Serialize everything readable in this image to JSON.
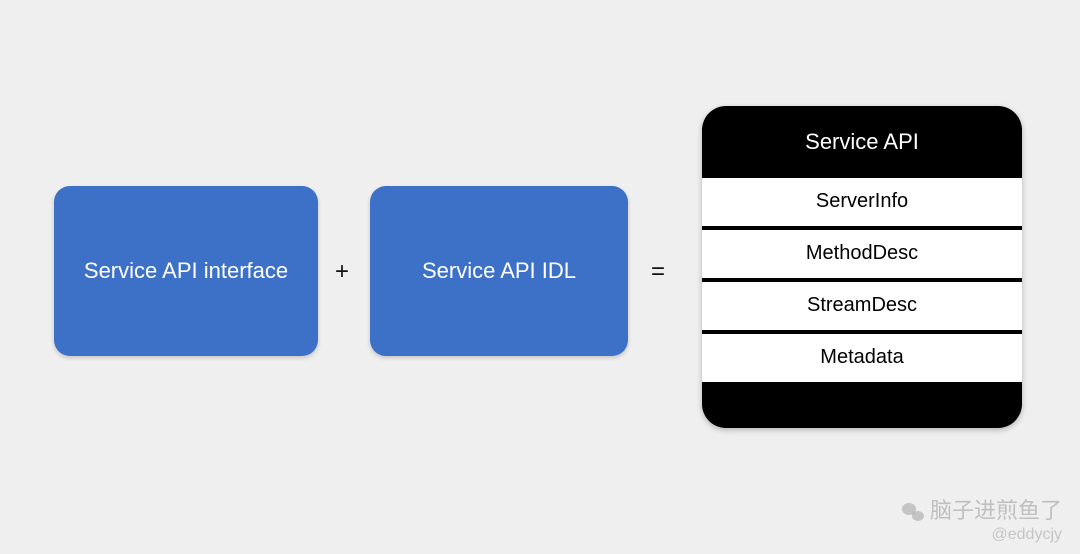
{
  "boxes": {
    "left": {
      "label": "Service API interface"
    },
    "right": {
      "label": "Service API IDL"
    }
  },
  "operators": {
    "plus": "+",
    "equal": "="
  },
  "result_card": {
    "title": "Service API",
    "rows": [
      "ServerInfo",
      "MethodDesc",
      "StreamDesc",
      "Metadata"
    ]
  },
  "attribution": {
    "cn": "脑子进煎鱼了",
    "handle": "@eddycjy"
  }
}
